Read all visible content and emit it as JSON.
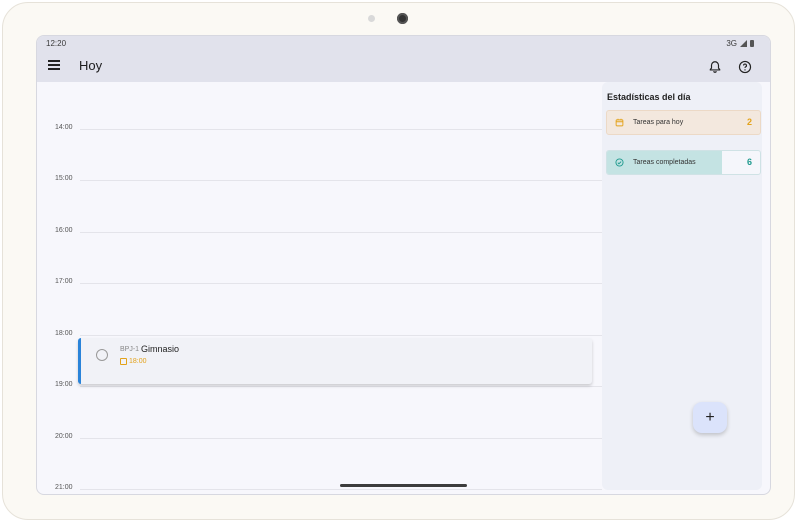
{
  "status_bar": {
    "time": "12:20",
    "network": "3G"
  },
  "app_bar": {
    "title": "Hoy",
    "menu_icon": "menu-icon",
    "notification_icon": "bell-icon",
    "help_icon": "help-icon"
  },
  "timeline": {
    "hours": [
      "14:00",
      "15:00",
      "16:00",
      "17:00",
      "18:00",
      "19:00",
      "20:00",
      "21:00"
    ]
  },
  "task": {
    "code": "BPJ-1",
    "name": "Gimnasio",
    "time": "18:00",
    "accent": "#2a83d9"
  },
  "stats": {
    "title": "Estadísticas del día",
    "today": {
      "label": "Tareas para hoy",
      "value": "2",
      "color": "#e3a21a"
    },
    "completed": {
      "label": "Tareas completadas",
      "value": "6",
      "color": "#1f9a8e",
      "fill_fraction": 0.75
    }
  },
  "fab": {
    "label": "+"
  }
}
